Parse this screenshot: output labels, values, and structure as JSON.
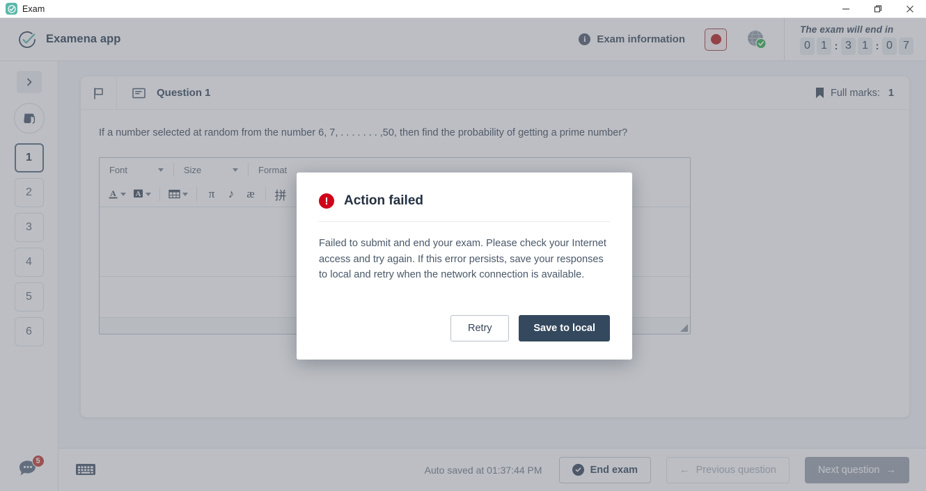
{
  "window": {
    "title": "Exam",
    "minimize_label": "Minimize",
    "maximize_label": "Restore",
    "close_label": "Close"
  },
  "header": {
    "brand_name": "Examena app",
    "exam_information_label": "Exam information",
    "record_label": "Recording",
    "network_label": "Network connected",
    "timer_label": "The exam will end in",
    "timer_digits": [
      "0",
      "1",
      "3",
      "1",
      "0",
      "7"
    ],
    "timer_value": "01:31:07"
  },
  "sidebar": {
    "collapse_label": "›",
    "scroll_label": "Question list",
    "questions": [
      {
        "label": "1",
        "active": true
      },
      {
        "label": "2",
        "active": false
      },
      {
        "label": "3",
        "active": false
      },
      {
        "label": "4",
        "active": false
      },
      {
        "label": "5",
        "active": false
      },
      {
        "label": "6",
        "active": false
      }
    ],
    "chat_badge": "5",
    "chat_label": "Messages"
  },
  "question": {
    "flag_label": "Flag question",
    "note_label": "Question notes",
    "title": "Question 1",
    "full_marks_label": "Full marks:",
    "full_marks_value": "1",
    "text": "If a number selected at random from the number 6, 7, . . . . . . . ,50, then find the probability of getting a prime number?"
  },
  "editor": {
    "font_label": "Font",
    "size_label": "Size",
    "format_label": "Format",
    "tools": [
      {
        "name": "text-color-icon",
        "glyph": "A"
      },
      {
        "name": "background-color-icon",
        "glyph": "A"
      },
      {
        "name": "table-icon",
        "glyph": "▦"
      },
      {
        "name": "math-icon",
        "glyph": "π"
      },
      {
        "name": "music-icon",
        "glyph": "♪"
      },
      {
        "name": "special-character-icon",
        "glyph": "æ"
      },
      {
        "name": "pinyin-icon",
        "glyph": "拼"
      }
    ],
    "content": ""
  },
  "bottombar": {
    "keyboard_label": "Virtual keyboard",
    "autosave_text": "Auto saved at 01:37:44 PM",
    "end_exam_label": "End exam",
    "previous_label": "Previous question",
    "previous_arrow": "←",
    "next_label": "Next question",
    "next_arrow": "→"
  },
  "modal": {
    "title": "Action failed",
    "icon_glyph": "!",
    "body": "Failed to submit and end your exam. Please check your Internet access and try again. If this error persists, save your responses to local and retry when the network connection is available.",
    "retry_label": "Retry",
    "save_label": "Save to local"
  },
  "colors": {
    "brand_teal": "#5cb8ab",
    "primary_dark": "#34495e",
    "error_red": "#d0021b",
    "record_red": "#b31b1b",
    "badge_red": "#c0392b",
    "network_green": "#2eaf4e",
    "page_bg": "#f4f5f7"
  }
}
